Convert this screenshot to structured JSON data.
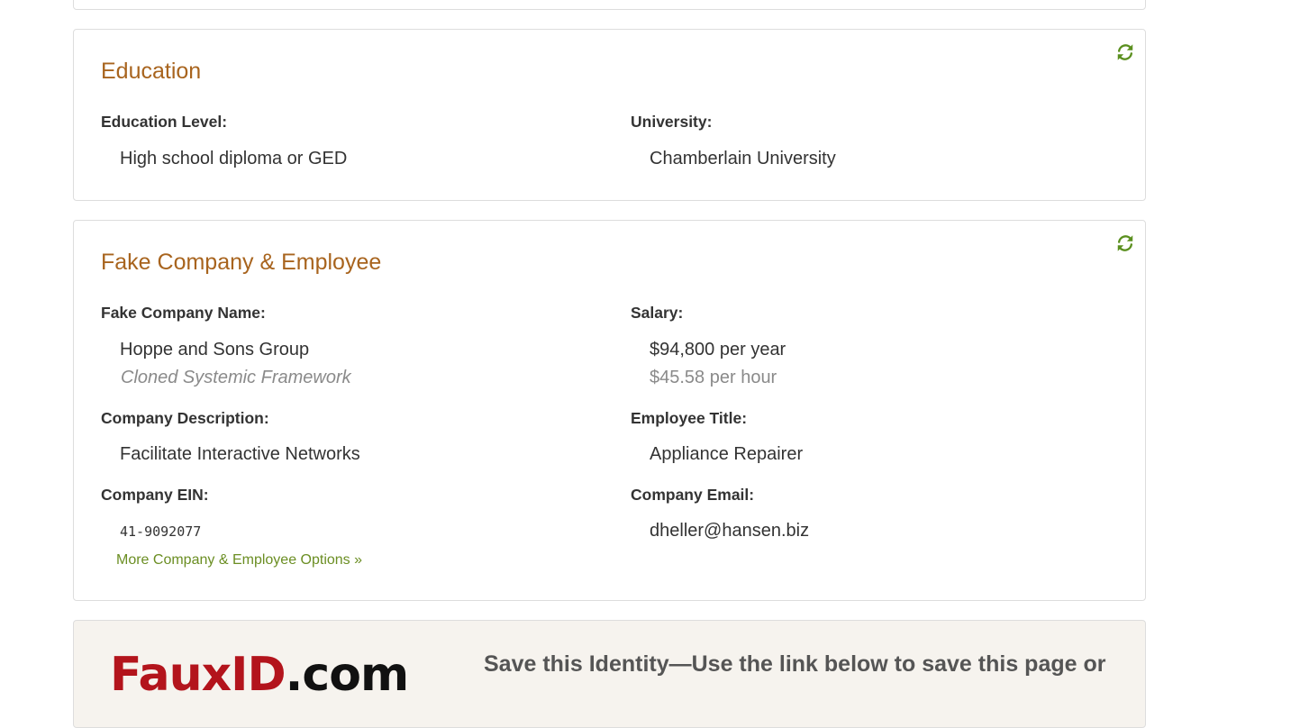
{
  "education": {
    "title": "Education",
    "level_label": "Education Level:",
    "level_value": "High school diploma or GED",
    "university_label": "University:",
    "university_value": "Chamberlain University",
    "refresh_icon": "refresh-icon"
  },
  "company": {
    "title": "Fake Company & Employee",
    "name_label": "Fake Company Name:",
    "name_value": "Hoppe and Sons Group",
    "name_tagline": "Cloned Systemic Framework",
    "salary_label": "Salary:",
    "salary_year": "$94,800 per year",
    "salary_hour": "$45.58 per hour",
    "description_label": "Company Description:",
    "description_value": "Facilitate Interactive Networks",
    "title_label": "Employee Title:",
    "title_value": "Appliance Repairer",
    "ein_label": "Company EIN:",
    "ein_value": "41-9092077",
    "email_label": "Company Email:",
    "email_value": "dheller@hansen.biz",
    "more_link": "More Company & Employee Options »",
    "refresh_icon": "refresh-icon"
  },
  "save": {
    "logo_main": "FauxID",
    "logo_suffix": ".com",
    "heading": "Save this Identity",
    "text": "—Use the link below to save this page or"
  },
  "colors": {
    "title": "#a8641e",
    "link": "#6b8e23",
    "icon": "#5a8f1e",
    "logo_red": "#b3141c"
  }
}
